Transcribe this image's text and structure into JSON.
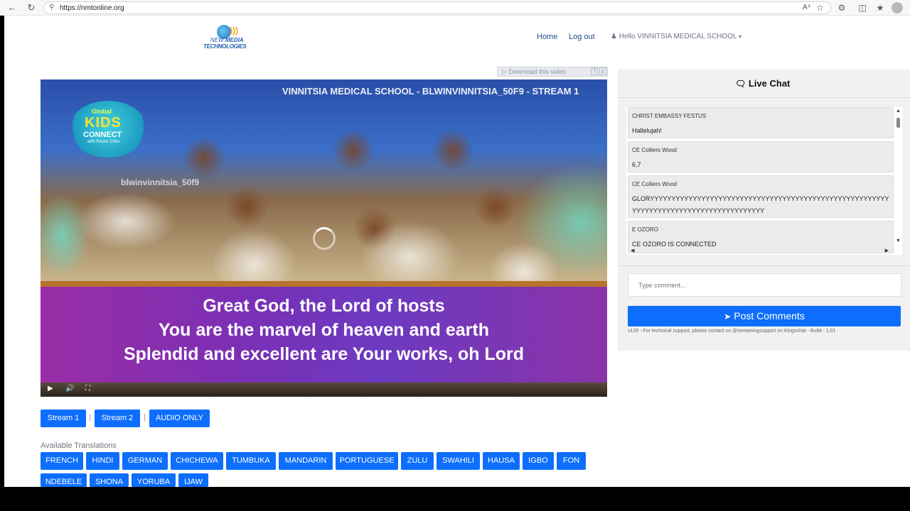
{
  "browser": {
    "url": "https://nmtonline.org",
    "read_aloud": "A⁴",
    "icons": [
      "back-icon",
      "refresh-icon",
      "lock-icon",
      "star-icon",
      "extensions-icon",
      "split-icon",
      "favorites-icon",
      "profile-icon"
    ]
  },
  "site": {
    "logo_line1_a": "NEW ",
    "logo_line1_b": "MEDIA",
    "logo_line2": "TECHNOLOGIES",
    "nav_home": "Home",
    "nav_logout": "Log out",
    "user_greeting": "Hello VINNITSIA MEDICAL SCHOOL"
  },
  "video": {
    "download_label": "Download this video",
    "download_help": "?",
    "download_close": "x",
    "stream_title": "VINNITSIA MEDICAL SCHOOL - BLWINVINNITSIA_50F9 - STREAM 1",
    "watermark": "blwinvinnitsia_50f9",
    "kids_logo_top": "Global",
    "kids_logo_main": "KIDS",
    "kids_logo_sub": "CONNECT",
    "kids_logo_tag": "with Pastor Chris",
    "lyrics": [
      "Great God, the Lord of hosts",
      "You are the marvel of heaven and earth",
      "Splendid and excellent are Your works, oh Lord"
    ],
    "controls": {
      "play": "▶",
      "volume": "🔊",
      "fullscreen": "⛶"
    }
  },
  "streams": {
    "stream1": "Stream 1",
    "stream2": "Stream 2",
    "audio": "AUDIO ONLY",
    "separator": "|"
  },
  "translations": {
    "label": "Available Translations",
    "languages": [
      "FRENCH",
      "HINDI",
      "GERMAN",
      "CHICHEWA",
      "TUMBUKA",
      "MANDARIN",
      "PORTUGUESE",
      "ZULU",
      "SWAHILI",
      "HAUSA",
      "IGBO",
      "FON",
      "NDEBELE",
      "SHONA",
      "YORUBA",
      "IJAW"
    ]
  },
  "chat": {
    "title": "Live Chat",
    "messages": [
      {
        "name": "CHRIST EMBASSY FESTUS",
        "text": "Hallelujah!"
      },
      {
        "name": "CE Colliers Wood",
        "text": "6,7"
      },
      {
        "name": "CE Colliers Wood",
        "text": "GLORYYYYYYYYYYYYYYYYYYYYYYYYYYYYYYYYYYYYYYYYYYYYYYYYYYYYYYYYYYYYYYYYYYYYYYYYYYYYYYYYYYYYYYY"
      },
      {
        "name": "E OZORO",
        "text": "CE OZORO IS CONNECTED"
      }
    ],
    "input_placeholder": "Type comment...",
    "post_label": "Post Comments",
    "support_text": "v126 - For technical support, please contact us @streamingsupport on Kingschat - Build - 1.01"
  },
  "colors": {
    "accent": "#0d6efd",
    "nav_text": "#26488a"
  }
}
